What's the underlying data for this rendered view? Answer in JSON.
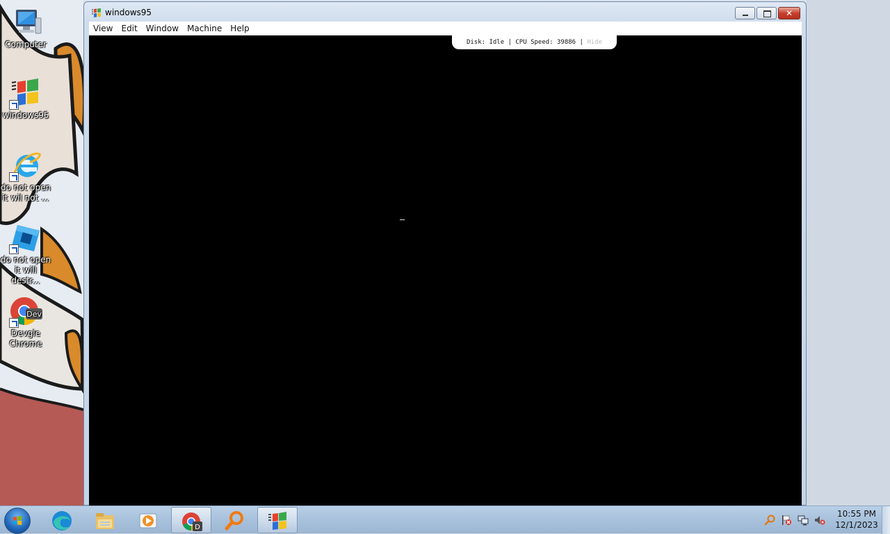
{
  "desktop": {
    "icons": [
      {
        "name": "Computer",
        "icon": "computer-icon",
        "shortcut": false
      },
      {
        "name": "windows95",
        "icon": "windows95-logo-icon",
        "shortcut": true
      },
      {
        "name": "do not open it wil not...",
        "line1": "do not open",
        "line2": "it wil not ...",
        "icon": "internet-explorer-icon",
        "shortcut": true
      },
      {
        "name": "do not open it will destr...",
        "line1": "do not open",
        "line2": "it will destr...",
        "icon": "roblox-studio-icon",
        "shortcut": true
      },
      {
        "name": "Devgle Chrome",
        "line1": "Devgle",
        "line2": "Chrome",
        "icon": "chrome-dev-icon",
        "badge": "Dev",
        "shortcut": true
      }
    ]
  },
  "window": {
    "title": "windows95",
    "menu": [
      "View",
      "Edit",
      "Window",
      "Machine",
      "Help"
    ],
    "status": {
      "text": "Disk: Idle | CPU Speed: 39886 | ",
      "hide_label": "Hide"
    },
    "cursor_char": "_"
  },
  "taskbar": {
    "pinned": [
      {
        "icon": "edge-icon",
        "active": false
      },
      {
        "icon": "file-explorer-icon",
        "active": false
      },
      {
        "icon": "media-player-icon",
        "active": false
      },
      {
        "icon": "chrome-dev-icon",
        "active": true,
        "badge": "D"
      },
      {
        "icon": "search-magnifier-icon",
        "active": false
      },
      {
        "icon": "windows95-logo-icon",
        "active": true
      }
    ],
    "tray": [
      "magnifier-tray-icon",
      "action-center-flag-icon",
      "network-icon",
      "volume-muted-icon"
    ],
    "clock": {
      "time": "10:55 PM",
      "date": "12/1/2023"
    }
  },
  "colors": {
    "screen": "#000000",
    "accent": "#1f64b5",
    "close": "#c8402e"
  }
}
